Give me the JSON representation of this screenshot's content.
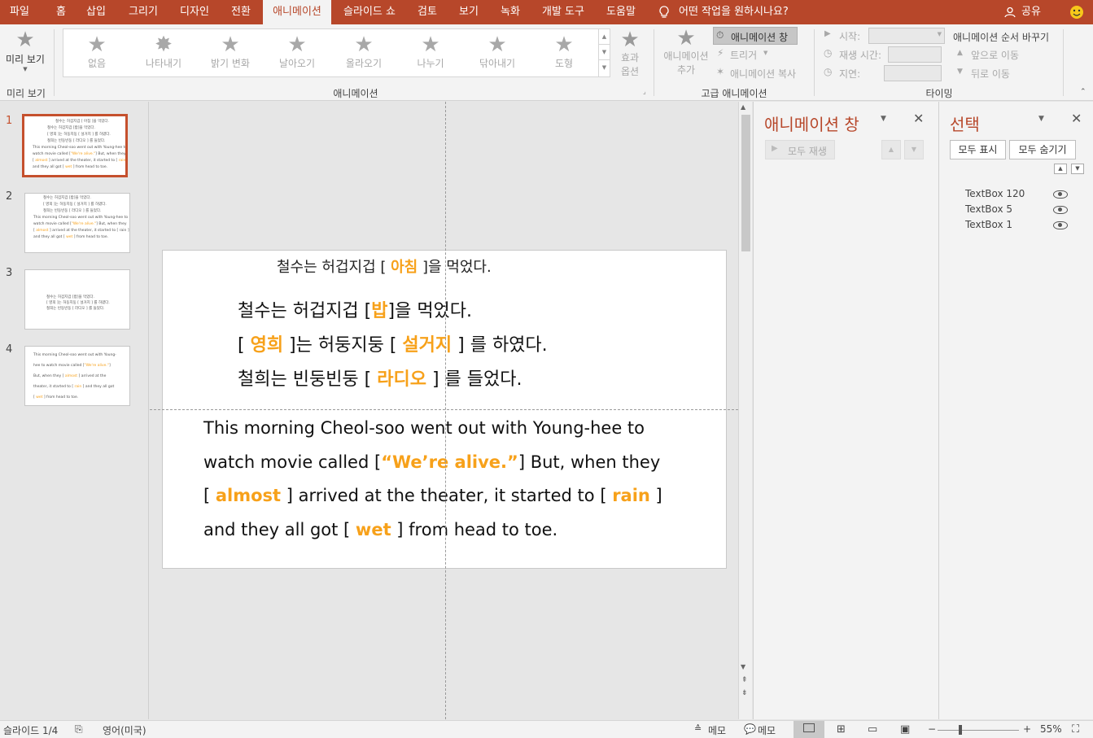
{
  "tabs": [
    "파일",
    "홈",
    "삽입",
    "그리기",
    "디자인",
    "전환",
    "애니메이션",
    "슬라이드 쇼",
    "검토",
    "보기",
    "녹화",
    "개발 도구",
    "도움말"
  ],
  "active_tab": "애니메이션",
  "tell_me": "어떤 작업을 원하시나요?",
  "share": "공유",
  "ribbon": {
    "preview_label": "미리 보기",
    "preview_group": "미리 보기",
    "animation_group": "애니메이션",
    "gallery": [
      "없음",
      "나타내기",
      "밝기 변화",
      "날아오기",
      "올라오기",
      "나누기",
      "닦아내기",
      "도형"
    ],
    "effect_options_1": "효과",
    "effect_options_2": "옵션",
    "add_anim_1": "애니메이션",
    "add_anim_2": "추가",
    "anim_pane_btn": "애니메이션 창",
    "trigger": "트리거",
    "anim_painter": "애니메이션 복사",
    "advanced_group": "고급 애니메이션",
    "start": "시작:",
    "duration": "재생 시간:",
    "delay": "지연:",
    "reorder": "애니메이션 순서 바꾸기",
    "move_earlier": "앞으로 이동",
    "move_later": "뒤로 이동",
    "timing_group": "타이밍"
  },
  "thumbs": [
    "1",
    "2",
    "3",
    "4"
  ],
  "slide": {
    "title_pre": "철수는 허겁지겁 [ ",
    "title_word": "아침",
    "title_post": " ]을 먹었다.",
    "l1_pre": "철수는 허겁지겁 [",
    "l1_word": "밥",
    "l1_post": "]을 먹었다.",
    "l2_pre": "[  ",
    "l2_word1": "영희",
    "l2_mid": "  ]는 허둥지둥 [ ",
    "l2_word2": "설거지",
    "l2_post": " ] 를 하였다.",
    "l3_pre": "철희는 빈둥빈둥 [ ",
    "l3_word": "라디오",
    "l3_post": " ] 를 들었다.",
    "e1": "This morning Cheol-soo went out with Young-hee to",
    "e2_pre": "watch movie called [",
    "e2_word": "“We’re alive.”",
    "e2_post": "] But, when they",
    "e3_a": "[ ",
    "e3_w1": "almost",
    "e3_b": " ]  arrived at the theater, it started to [ ",
    "e3_w2": "rain",
    "e3_c": " ]",
    "e4_pre": "and they all got [ ",
    "e4_word": "wet",
    "e4_post": " ] from head to toe."
  },
  "anim_pane": {
    "title": "애니메이션 창",
    "play_all": "모두 재생"
  },
  "sel_pane": {
    "title": "선택",
    "show_all": "모두 표시",
    "hide_all": "모두 숨기기",
    "objects": [
      "TextBox 120",
      "TextBox 5",
      "TextBox 1"
    ]
  },
  "status": {
    "slide": "슬라이드 1/4",
    "lang": "영어(미국)",
    "notes": "메모",
    "comments": "메모",
    "zoom": "55%"
  },
  "colors": {
    "accent": "#b7472a",
    "highlight": "#f7a11a"
  }
}
